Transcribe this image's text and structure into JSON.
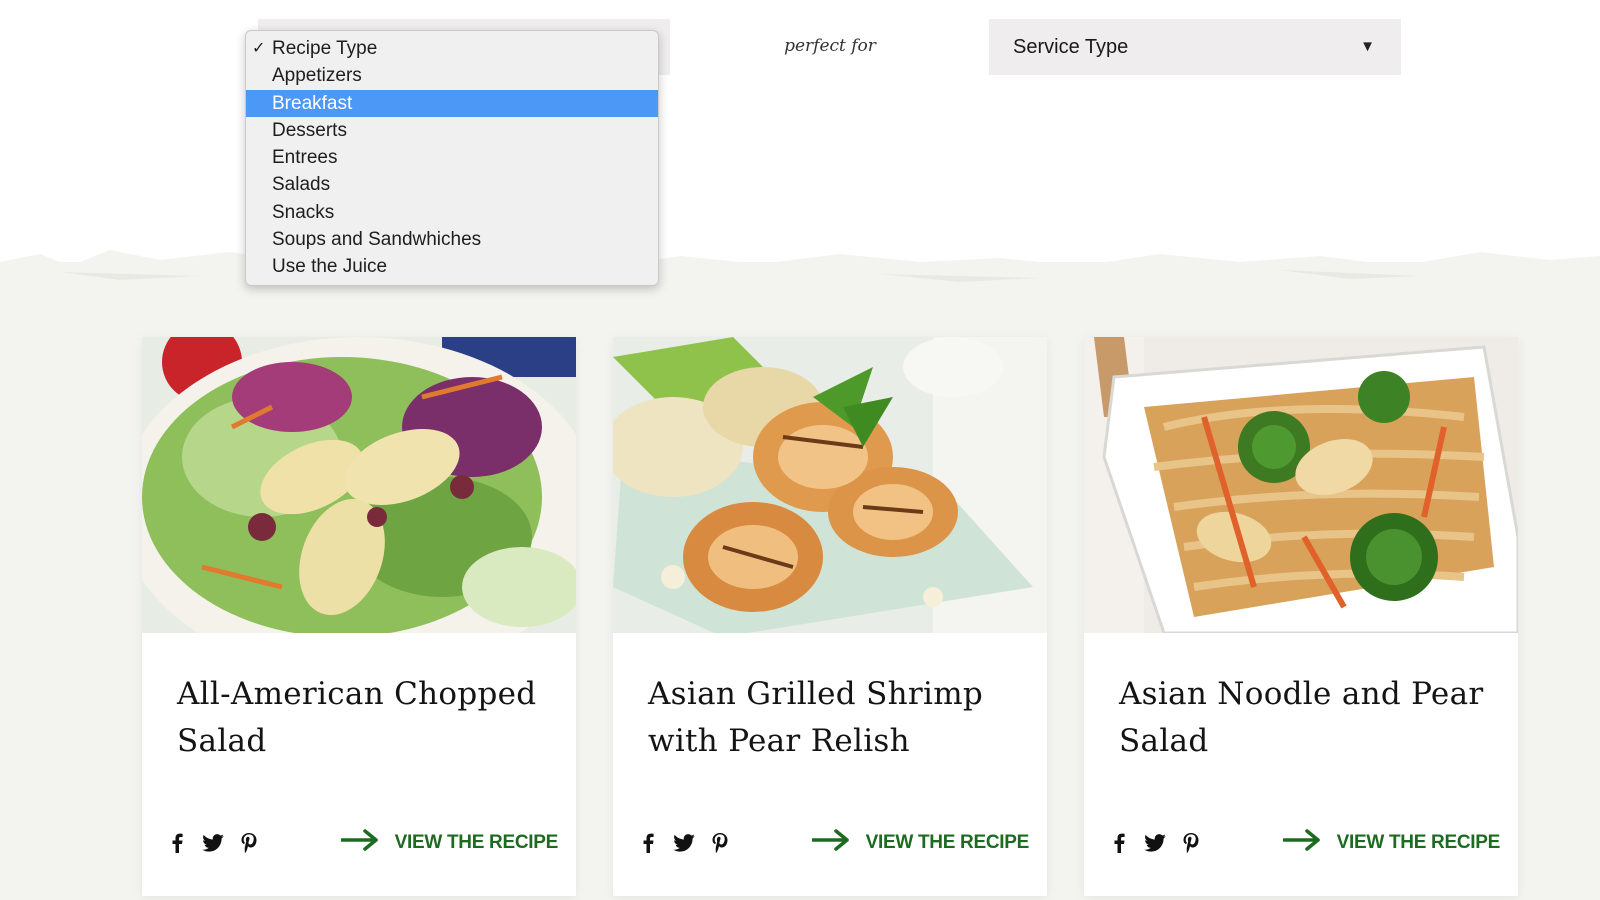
{
  "filters": {
    "connector": "perfect for",
    "service_select": {
      "value": "Service Type",
      "arrow": "▼"
    },
    "recipe_dropdown": {
      "check_mark": "✓",
      "options": [
        "Recipe Type",
        "Appetizers",
        "Breakfast",
        "Desserts",
        "Entrees",
        "Salads",
        "Snacks",
        "Soups and Sandwhiches",
        "Use the Juice"
      ],
      "checked_option": "Recipe Type",
      "highlighted_option": "Breakfast"
    }
  },
  "cards": [
    {
      "title": "All-American Chopped Salad",
      "image": "chopped-salad-photo",
      "cta": "VIEW THE RECIPE"
    },
    {
      "title": "Asian Grilled Shrimp with Pear Relish",
      "image": "grilled-shrimp-photo",
      "cta": "VIEW THE RECIPE"
    },
    {
      "title": "Asian Noodle and Pear Salad",
      "image": "noodle-salad-photo",
      "cta": "VIEW THE RECIPE"
    }
  ],
  "social_icons": [
    "facebook-icon",
    "twitter-icon",
    "pinterest-icon"
  ],
  "colors": {
    "cta_green": "#1d6b21",
    "highlight_blue": "#4b98f7",
    "select_bg": "#efeded",
    "page_band": "#f3f3ef"
  }
}
